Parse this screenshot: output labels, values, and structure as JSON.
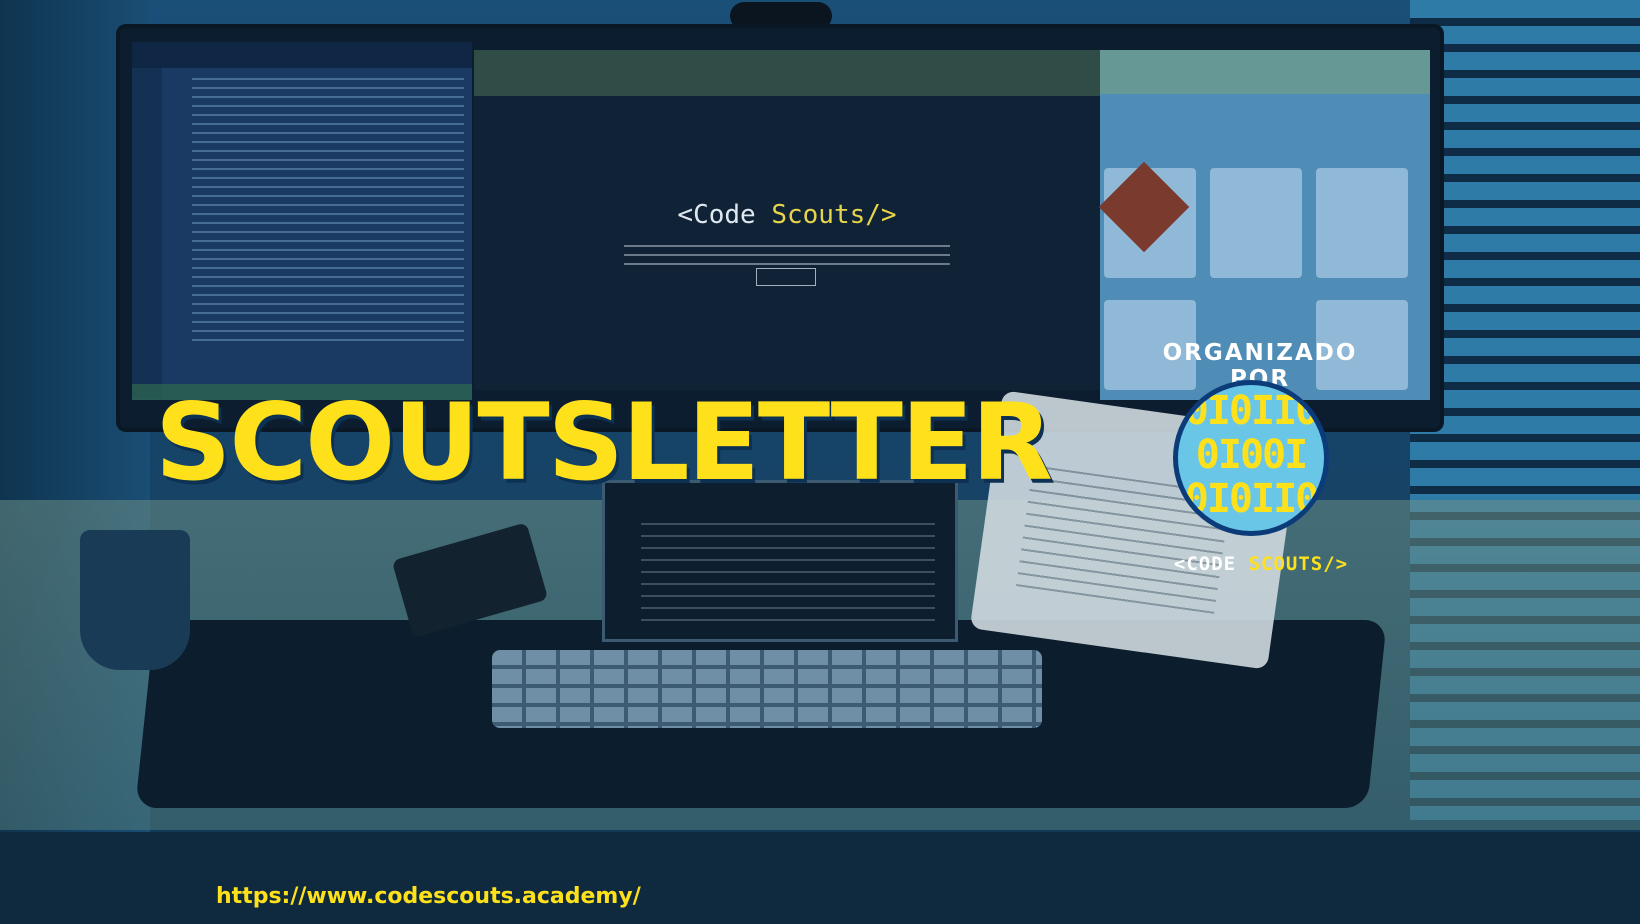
{
  "banner": {
    "title": "SCOUTSLETTER",
    "organized_by": "ORGANIZADO POR",
    "brand_prefix": "<CODE ",
    "brand_accent": "SCOUTS/>",
    "logo_digits": [
      "0I0II0",
      "0I00I",
      "0I0II0"
    ],
    "url": "https://www.codescouts.academy/",
    "colors": {
      "accent": "#fee11a",
      "overlay": "#17456b",
      "logo_bg": "#69c6e6",
      "logo_ring": "#0c3b7a",
      "text": "#ffffff"
    }
  },
  "background": {
    "mid_brand_prefix": "<Code ",
    "mid_brand_accent": "Scouts/>"
  },
  "icons": {
    "logo": "binary-circle-logo-icon",
    "git": "git-logo-icon"
  }
}
